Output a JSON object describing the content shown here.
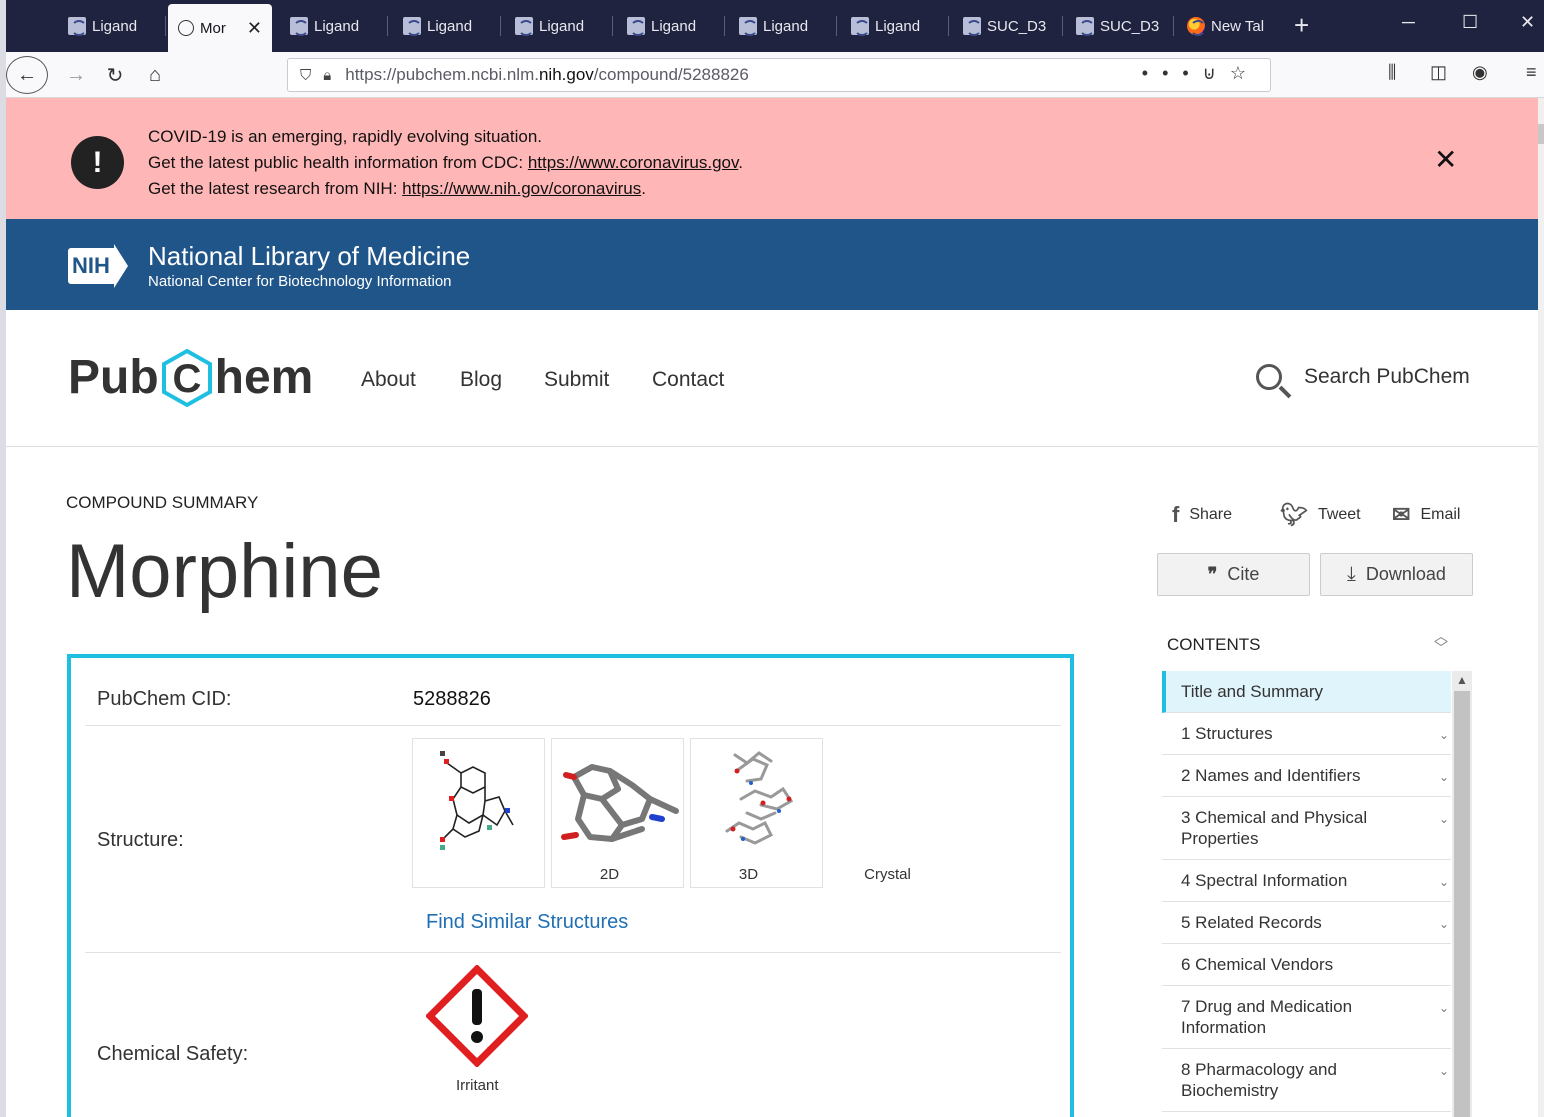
{
  "browser": {
    "tabs": [
      {
        "label": "Ligand",
        "active": false
      },
      {
        "label": "Mor",
        "active": true
      },
      {
        "label": "Ligand",
        "active": false
      },
      {
        "label": "Ligand",
        "active": false
      },
      {
        "label": "Ligand",
        "active": false
      },
      {
        "label": "Ligand",
        "active": false
      },
      {
        "label": "Ligand",
        "active": false
      },
      {
        "label": "Ligand",
        "active": false
      },
      {
        "label": "SUC_D3",
        "active": false
      },
      {
        "label": "SUC_D3",
        "active": false
      },
      {
        "label": "New Tal",
        "active": false
      }
    ],
    "url_prefix": "https://pubchem.ncbi.nlm.",
    "url_domain": "nih.gov",
    "url_path": "/compound/5288826"
  },
  "alert": {
    "line1": "COVID-19 is an emerging, rapidly evolving situation.",
    "line2_text": "Get the latest public health information from CDC: ",
    "line2_link": "https://www.coronavirus.gov",
    "line3_text": "Get the latest research from NIH: ",
    "line3_link": "https://www.nih.gov/coronavirus",
    "close": "✕"
  },
  "nlm": {
    "logo": "NIH",
    "title": "National Library of Medicine",
    "subtitle": "National Center for Biotechnology Information"
  },
  "pubchem": {
    "logo_pre": "Pub",
    "logo_c": "C",
    "logo_post": "hem",
    "menu": [
      "About",
      "Blog",
      "Submit",
      "Contact"
    ],
    "search_label": "Search PubChem"
  },
  "compound": {
    "kicker": "COMPOUND SUMMARY",
    "name": "Morphine",
    "cid_label": "PubChem CID:",
    "cid_value": "5288826",
    "structure_label": "Structure:",
    "structure_thumbs": [
      "2D",
      "3D",
      "Crystal"
    ],
    "find_similar": "Find Similar Structures",
    "safety_label": "Chemical Safety:",
    "safety_pictogram": "Irritant"
  },
  "sidebar": {
    "share": "Share",
    "tweet": "Tweet",
    "email": "Email",
    "cite": "Cite",
    "download": "Download",
    "contents_heading": "CONTENTS",
    "toc": [
      {
        "label": "Title and Summary",
        "active": true,
        "chevron": false
      },
      {
        "label": "1 Structures",
        "active": false,
        "chevron": true
      },
      {
        "label": "2 Names and Identifiers",
        "active": false,
        "chevron": true
      },
      {
        "label": "3 Chemical and Physical Properties",
        "active": false,
        "chevron": true
      },
      {
        "label": "4 Spectral Information",
        "active": false,
        "chevron": true
      },
      {
        "label": "5 Related Records",
        "active": false,
        "chevron": true
      },
      {
        "label": "6 Chemical Vendors",
        "active": false,
        "chevron": false
      },
      {
        "label": "7 Drug and Medication Information",
        "active": false,
        "chevron": true
      },
      {
        "label": "8 Pharmacology and Biochemistry",
        "active": false,
        "chevron": true
      }
    ]
  },
  "colors": {
    "alert_bg": "#ffb6b6",
    "nlm_blue": "#20558a",
    "accent_cyan": "#1ebfe0",
    "link_blue": "#1f6fb5"
  }
}
